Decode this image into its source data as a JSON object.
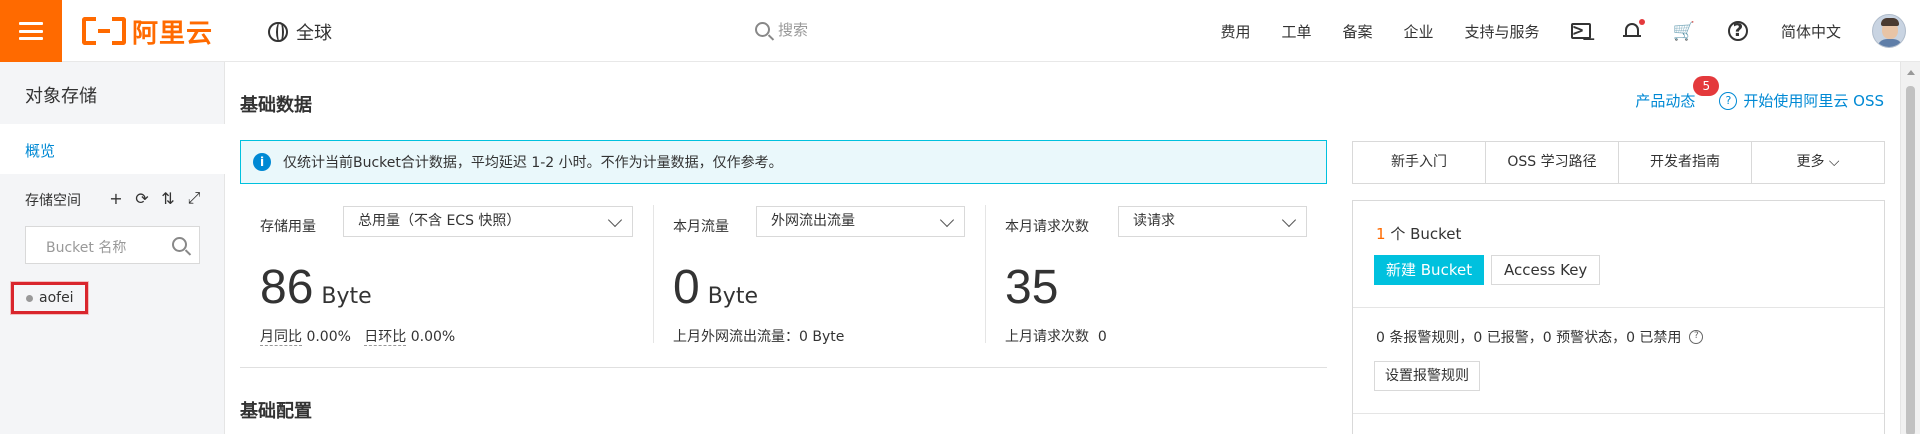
{
  "topbar": {
    "logo_text": "阿里云",
    "region": "全球",
    "search_placeholder": "搜索",
    "nav": [
      "费用",
      "工单",
      "备案",
      "企业",
      "支持与服务"
    ],
    "language": "简体中文",
    "icons": [
      "terminal-icon",
      "bell-icon",
      "cart-icon",
      "help-icon"
    ],
    "accent_color": "#ff6a00"
  },
  "sidebar": {
    "title": "对象存储",
    "nav_overview": "概览",
    "section_label": "存储空间",
    "tools": [
      "+",
      "⟳",
      "⇅",
      "⤢"
    ],
    "search_placeholder": "Bucket 名称",
    "buckets": [
      "aofei"
    ]
  },
  "main": {
    "title": "基础数据",
    "product_news": "产品动态",
    "news_badge": "5",
    "get_started": "开始使用阿里云 OSS",
    "info": "仅统计当前Bucket合计数据，平均延迟 1-2 小时。不作为计量数据，仅作参考。",
    "storage": {
      "label": "存储用量",
      "select": "总用量（不含 ECS 快照）",
      "value": "86",
      "unit": "Byte",
      "yoy_label": "月同比",
      "yoy": "0.00%",
      "mom_label": "日环比",
      "mom": "0.00%"
    },
    "traffic": {
      "label": "本月流量",
      "select": "外网流出流量",
      "value": "0",
      "unit": "Byte",
      "last_month": "上月外网流出流量：0 Byte"
    },
    "requests": {
      "label": "本月请求次数",
      "select": "读请求",
      "value": "35",
      "last_month_label": "上月请求次数",
      "last_month_value": "0"
    },
    "section2_title": "基础配置"
  },
  "right_panel": {
    "tabs": [
      "新手入门",
      "OSS 学习路径",
      "开发者指南",
      "更多"
    ],
    "bucket_count": "1",
    "bucket_count_suffix": " 个 Bucket",
    "create_bucket": "新建 Bucket",
    "access_key": "Access Key",
    "alarm_text": "0 条报警规则，0 已报警，0 预警状态，0 已禁用",
    "set_alarm": "设置报警规则"
  }
}
